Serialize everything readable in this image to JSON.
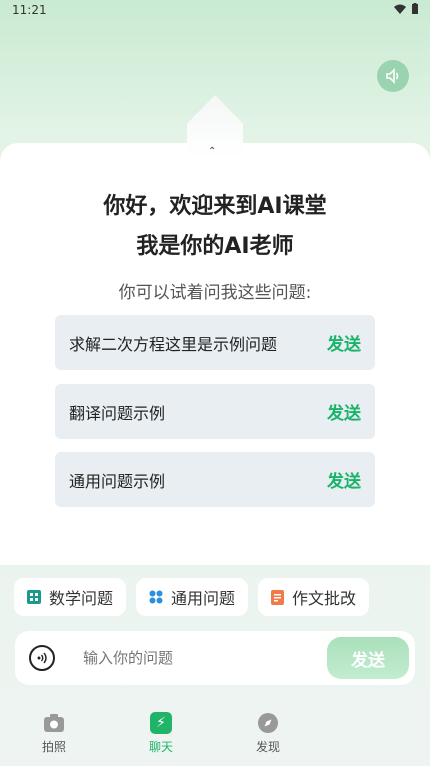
{
  "status": {
    "time": "11:21"
  },
  "greeting": {
    "line1": "你好，欢迎来到AI课堂",
    "line2": "我是你的AI老师"
  },
  "hint": "你可以试着问我这些问题:",
  "questions": [
    {
      "text": "求解二次方程这里是示例问题",
      "send": "发送"
    },
    {
      "text": "翻译问题示例",
      "send": "发送"
    },
    {
      "text": "通用问题示例",
      "send": "发送"
    }
  ],
  "chips": [
    {
      "label": "数学问题",
      "icon": "math-grid-icon"
    },
    {
      "label": "通用问题",
      "icon": "apps-icon"
    },
    {
      "label": "作文批改",
      "icon": "document-icon"
    }
  ],
  "input": {
    "placeholder": "输入你的问题",
    "send": "发送"
  },
  "tabs": [
    {
      "label": "拍照",
      "icon": "camera-icon"
    },
    {
      "label": "聊天",
      "icon": "chat-bolt-icon",
      "active": true
    },
    {
      "label": "发现",
      "icon": "compass-icon"
    }
  ],
  "colors": {
    "accent": "#19b46a",
    "chip_math": "#1a9a8a",
    "chip_general": "#2a8fe0",
    "chip_essay": "#f07a4a"
  }
}
